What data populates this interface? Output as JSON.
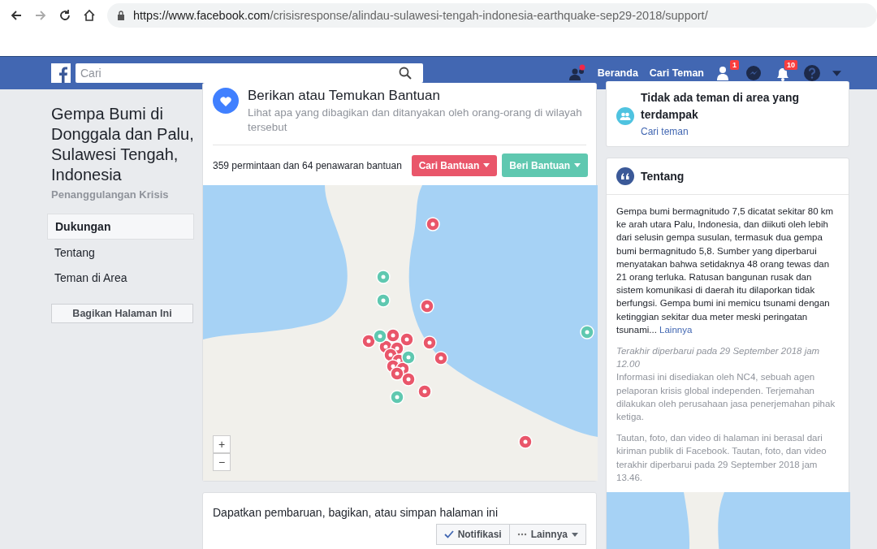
{
  "browser": {
    "url_domain": "https://www.facebook.com",
    "url_path": "/crisisresponse/alindau-sulawesi-tengah-indonesia-earthquake-sep29-2018/support/"
  },
  "navbar": {
    "search": {
      "placeholder": "Cari"
    },
    "links": [
      "Beranda",
      "Cari Teman"
    ],
    "friend_badge": "1",
    "notification_badge": "10"
  },
  "sidebar": {
    "title": "Gempa Bumi di Donggala dan Palu, Sulawesi Tengah, Indonesia",
    "subtitle": "Penanggulangan Krisis",
    "items": [
      {
        "label": "Dukungan",
        "selected": true
      },
      {
        "label": "Tentang",
        "selected": false
      },
      {
        "label": "Teman di Area",
        "selected": false
      }
    ],
    "share_button": "Bagikan Halaman Ini"
  },
  "help_card": {
    "title": "Berikan atau Temukan Bantuan",
    "subtitle": "Lihat apa yang dibagikan dan ditanyakan oleh orang-orang di wilayah tersebut",
    "summary": "359 permintaan dan 64 penawaran bantuan",
    "buttons": [
      {
        "label": "Cari Bantuan",
        "color": "#e9566a"
      },
      {
        "label": "Beri Bantuan",
        "color": "#5fc8b0"
      }
    ],
    "map": {
      "zoom_in": "+",
      "zoom_out": "−"
    }
  },
  "updates_card": {
    "text": "Dapatkan pembaruan, bagikan, atau simpan halaman ini",
    "buttons": [
      {
        "kind": "check",
        "label": "Notifikasi"
      },
      {
        "kind": "more",
        "label": "Lainnya"
      }
    ]
  },
  "friends_card": {
    "title": "Tidak ada teman di area yang terdampak",
    "link": "Cari teman"
  },
  "about_card": {
    "title": "Tentang",
    "description": "Gempa bumi bermagnitudo 7,5 dicatat sekitar 80 km ke arah utara Palu, Indonesia, dan diikuti oleh lebih dari selusin gempa susulan, termasuk dua gempa bumi bermagnitudo 5,8. Sumber yang diperbarui menyatakan bahwa setidaknya 48 orang tewas dan 21 orang terluka. Ratusan bangunan rusak dan sistem komunikasi di daerah itu dilaporkan tidak berfungsi. Gempa bumi ini memicu tsunami dengan ketinggian sekitar dua meter meski peringatan tsunami...",
    "more_link": "Lainnya",
    "updated": "Terakhir diperbarui pada 29 September 2018 jam 12.00",
    "source": "Informasi ini disediakan oleh NC4, sebuah agen pelaporan krisis global independen. Terjemahan dilakukan oleh perusahaan jasa penerjemahan pihak ketiga.",
    "note": "Tautan, foto, dan video di halaman ini berasal dari kiriman publik di Facebook. Tautan, foto, dan video terakhir diperbarui pada 29 September 2018 jam 13.46."
  }
}
